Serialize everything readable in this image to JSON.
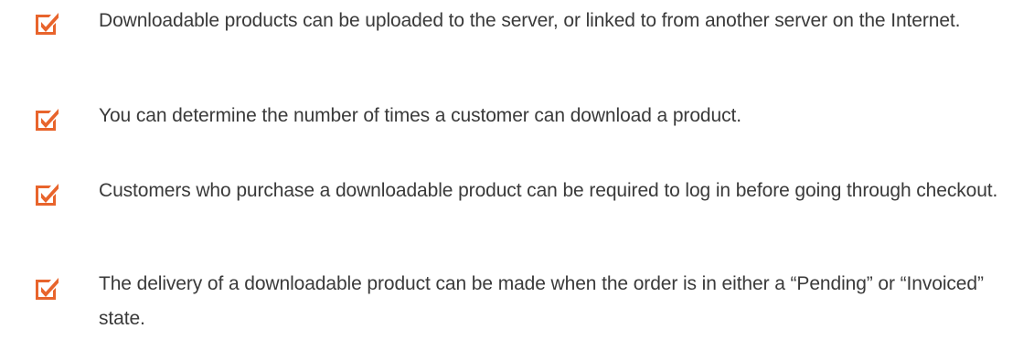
{
  "checklist": {
    "icon": "checkbox-checked-icon",
    "colors": {
      "icon_accent": "#e8642c",
      "text": "#3a3a3a"
    },
    "items": [
      {
        "text": "Downloadable products can be uploaded to the server, or linked to from another server on the Internet."
      },
      {
        "text": "You can determine the number of times a customer can download a product."
      },
      {
        "text": "Customers who purchase a downloadable product can be required to log in before going through checkout."
      },
      {
        "text": "The delivery of a downloadable product can be made when the order is in either a “Pending” or “Invoiced” state."
      }
    ]
  }
}
